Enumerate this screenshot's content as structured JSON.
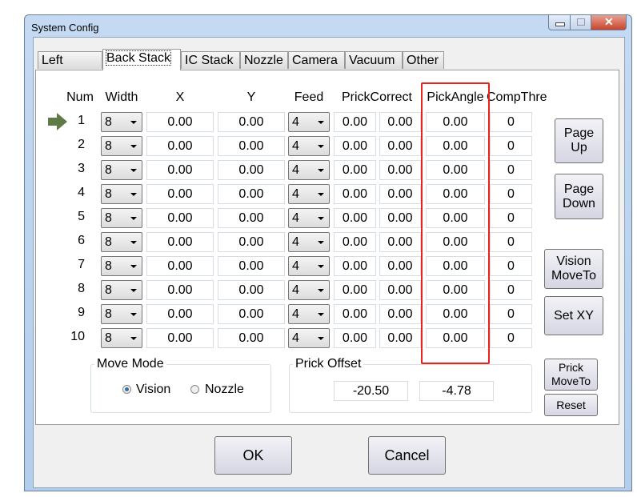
{
  "window": {
    "title": "System Config"
  },
  "tabs": [
    "Left Stack",
    "Back Stack",
    "IC Stack",
    "Nozzle",
    "Camera",
    "Vacuum",
    "Other"
  ],
  "active_tab": "Back Stack",
  "headers": {
    "num": "Num",
    "width": "Width",
    "x": "X",
    "y": "Y",
    "feed": "Feed",
    "prick_correct": "PrickCorrect",
    "pick_angle": "PickAngle",
    "comp_thre": "CompThre"
  },
  "rows": [
    {
      "num": "1",
      "width": "8",
      "x": "0.00",
      "y": "0.00",
      "feed": "4",
      "pc1": "0.00",
      "pc2": "0.00",
      "angle": "0.00",
      "comp": "0"
    },
    {
      "num": "2",
      "width": "8",
      "x": "0.00",
      "y": "0.00",
      "feed": "4",
      "pc1": "0.00",
      "pc2": "0.00",
      "angle": "0.00",
      "comp": "0"
    },
    {
      "num": "3",
      "width": "8",
      "x": "0.00",
      "y": "0.00",
      "feed": "4",
      "pc1": "0.00",
      "pc2": "0.00",
      "angle": "0.00",
      "comp": "0"
    },
    {
      "num": "4",
      "width": "8",
      "x": "0.00",
      "y": "0.00",
      "feed": "4",
      "pc1": "0.00",
      "pc2": "0.00",
      "angle": "0.00",
      "comp": "0"
    },
    {
      "num": "5",
      "width": "8",
      "x": "0.00",
      "y": "0.00",
      "feed": "4",
      "pc1": "0.00",
      "pc2": "0.00",
      "angle": "0.00",
      "comp": "0"
    },
    {
      "num": "6",
      "width": "8",
      "x": "0.00",
      "y": "0.00",
      "feed": "4",
      "pc1": "0.00",
      "pc2": "0.00",
      "angle": "0.00",
      "comp": "0"
    },
    {
      "num": "7",
      "width": "8",
      "x": "0.00",
      "y": "0.00",
      "feed": "4",
      "pc1": "0.00",
      "pc2": "0.00",
      "angle": "0.00",
      "comp": "0"
    },
    {
      "num": "8",
      "width": "8",
      "x": "0.00",
      "y": "0.00",
      "feed": "4",
      "pc1": "0.00",
      "pc2": "0.00",
      "angle": "0.00",
      "comp": "0"
    },
    {
      "num": "9",
      "width": "8",
      "x": "0.00",
      "y": "0.00",
      "feed": "4",
      "pc1": "0.00",
      "pc2": "0.00",
      "angle": "0.00",
      "comp": "0"
    },
    {
      "num": "10",
      "width": "8",
      "x": "0.00",
      "y": "0.00",
      "feed": "4",
      "pc1": "0.00",
      "pc2": "0.00",
      "angle": "0.00",
      "comp": "0"
    }
  ],
  "current_row": "1",
  "buttons": {
    "page_up": [
      "Page",
      "Up"
    ],
    "page_down": [
      "Page",
      "Down"
    ],
    "vision_moveto": [
      "Vision",
      "MoveTo"
    ],
    "set_xy": "Set XY",
    "prick_moveto": [
      "Prick",
      "MoveTo"
    ],
    "reset": "Reset",
    "ok": "OK",
    "cancel": "Cancel"
  },
  "move_mode": {
    "label": "Move Mode",
    "options": [
      "Vision",
      "Nozzle"
    ],
    "selected": "Vision"
  },
  "prick_offset": {
    "label": "Prick Offset",
    "x": "-20.50",
    "y": "-4.78"
  },
  "colors": {
    "highlight": "#e8231c",
    "arrow": "#5f7a45"
  }
}
